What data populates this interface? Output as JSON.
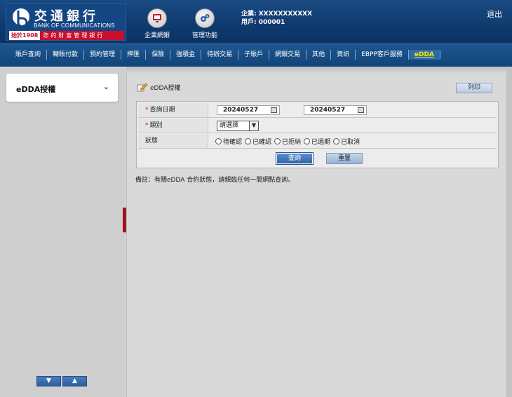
{
  "header": {
    "logo_cn": "交通銀行",
    "logo_en": "BANK OF COMMUNICATIONS",
    "since": "始於1908",
    "motto": "您的財富管理銀行",
    "buttons": [
      {
        "label": "企業網銀",
        "icon": "monitor-icon"
      },
      {
        "label": "管理功能",
        "icon": "gear-icon"
      }
    ],
    "company_line": "企業: XXXXXXXXXXX",
    "user_line": "用戶: 000001",
    "logout": "退出",
    "colors": {
      "primary": "#0f3a6e",
      "brand_red": "#c8102e",
      "active_menu": "#ffe600"
    }
  },
  "menu": [
    {
      "label": "賬戶查詢",
      "active": false
    },
    {
      "label": "轉賬付款",
      "active": false
    },
    {
      "label": "預約管理",
      "active": false
    },
    {
      "label": "押匯",
      "active": false
    },
    {
      "label": "保險",
      "active": false
    },
    {
      "label": "強積金",
      "active": false
    },
    {
      "label": "待辦交易",
      "active": false
    },
    {
      "label": "子賬戶",
      "active": false
    },
    {
      "label": "網銀交易",
      "active": false
    },
    {
      "label": "其他",
      "active": false
    },
    {
      "label": "資訊",
      "active": false
    },
    {
      "label": "EBPP客戶服務",
      "active": false
    },
    {
      "label": "eDDA",
      "active": true
    }
  ],
  "sidebar": {
    "item": "eDDA授權",
    "up": "▲",
    "down": "▼"
  },
  "page": {
    "title": "eDDA授權",
    "print": "列印",
    "form": {
      "date_label": "查詢日期",
      "date_from": "20240527",
      "date_to": "20240527",
      "type_label": "類別",
      "type_value": "請選擇",
      "status_label": "狀態",
      "status_options": [
        "待確認",
        "已確認",
        "已拒納",
        "已過期",
        "已取消"
      ],
      "required_mark": "*"
    },
    "query": "查詢",
    "reset": "重置",
    "note": "備註：有關eDDA 合約狀態，請親臨任何一間網點查詢。"
  }
}
